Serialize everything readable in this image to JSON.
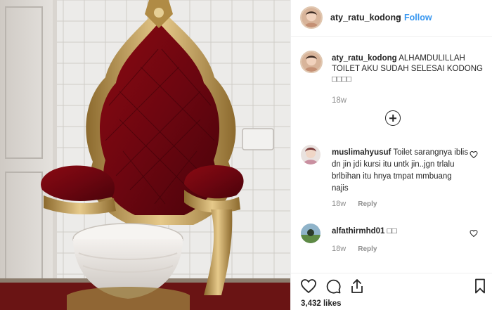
{
  "post": {
    "username": "aty_ratu_kodong",
    "dot": "•",
    "follow_label": "Follow"
  },
  "caption": {
    "username": "aty_ratu_kodong",
    "text": "ALHAMDULILLAH TOILET AKU SUDAH SELESAI KODONG",
    "emoji": "□□□□",
    "age": "18w"
  },
  "comments": [
    {
      "username": "muslimahyusuf",
      "text": "Toilet sarangnya iblis dn jin jdi kursi itu untk jin..jgn trlalu brlbihan itu hnya tmpat mmbuang najis",
      "age": "18w",
      "reply_label": "Reply"
    },
    {
      "username": "alfathirmhd01",
      "text": "□□",
      "age": "18w",
      "reply_label": "Reply"
    }
  ],
  "likes_count": "3,432 likes",
  "icons": {
    "like": "heart-icon",
    "comment": "comment-icon",
    "share": "share-icon",
    "save": "bookmark-icon",
    "more": "plus-circle-icon"
  },
  "colors": {
    "accent": "#3897f0",
    "muted": "#8e8e8e",
    "text": "#262626"
  }
}
